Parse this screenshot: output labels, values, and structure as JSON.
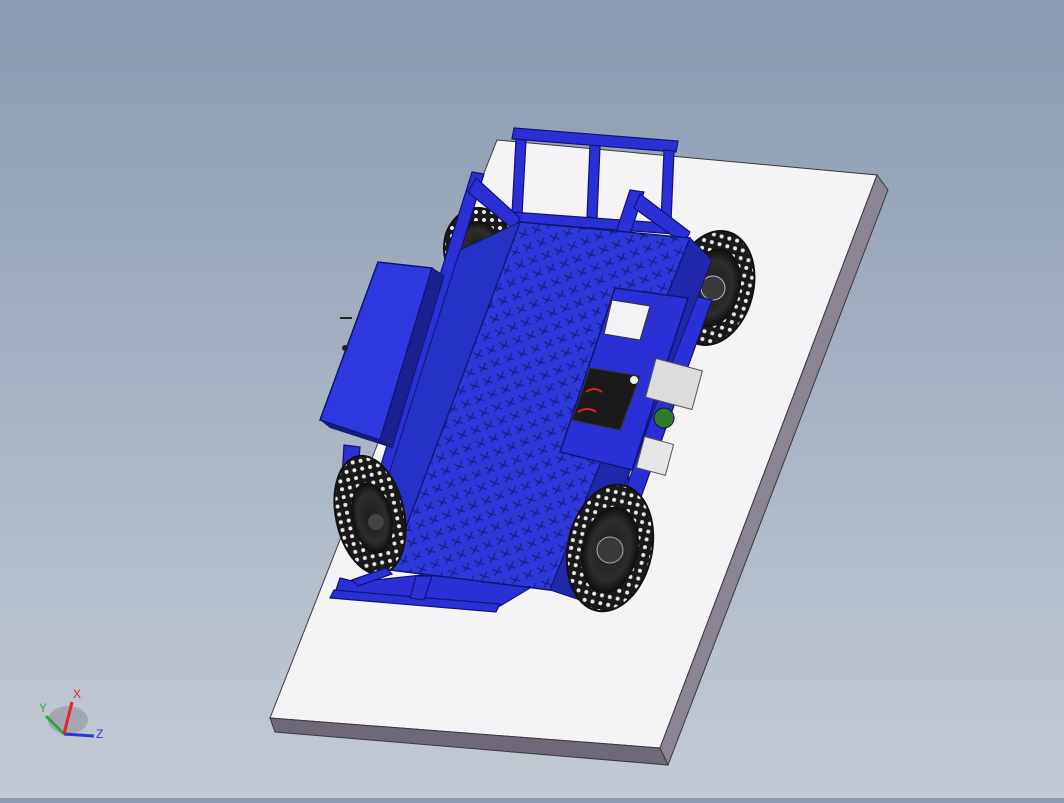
{
  "viewport": {
    "background_top": "#8a9ab0",
    "background_bottom": "#c3cad4",
    "model_color": "#2b2fd6",
    "plate_color": "#f4f4f6"
  },
  "triad": {
    "x_label": "X",
    "y_label": "Y",
    "z_label": "Z",
    "x_color": "#e0252b",
    "y_color": "#2faa3a",
    "z_color": "#2738d8"
  }
}
